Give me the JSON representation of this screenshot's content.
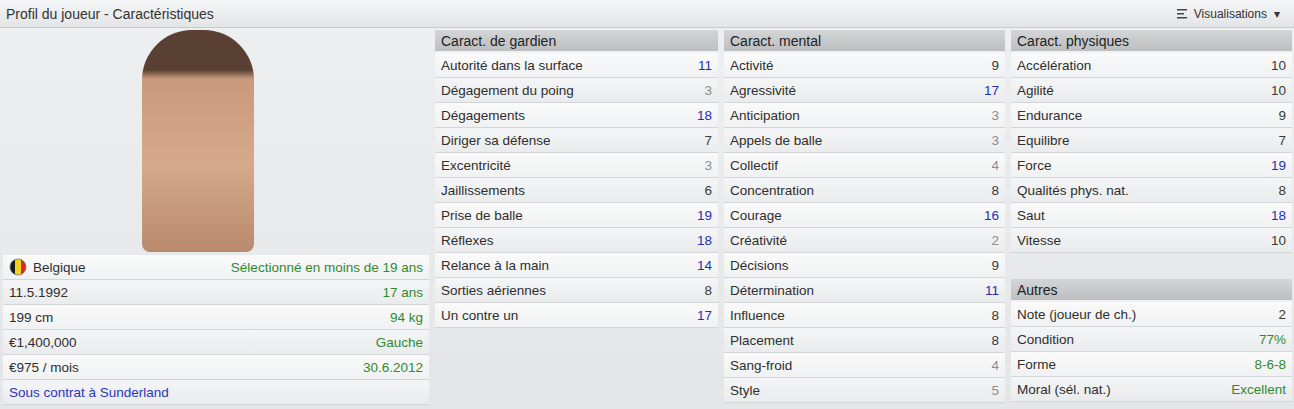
{
  "header": {
    "title": "Profil du joueur - Caractéristiques",
    "view_button": {
      "label": "Visualisations",
      "caret": "▾"
    }
  },
  "player": {
    "info_rows": [
      {
        "kind": "nation",
        "label": "Belgique",
        "value": "Sélectionné en moins de 19 ans"
      },
      {
        "kind": "pair",
        "label": "11.5.1992",
        "value": "17 ans"
      },
      {
        "kind": "pair",
        "label": "199 cm",
        "value": "94 kg"
      },
      {
        "kind": "pair",
        "label": "€1,400,000",
        "value": "Gauche"
      },
      {
        "kind": "pair",
        "label": "€975 / mois",
        "value": "30.6.2012"
      },
      {
        "kind": "link",
        "label": "Sous contrat à Sunderland",
        "value": ""
      }
    ]
  },
  "columns": [
    {
      "sections": [
        {
          "title": "Caract. de gardien",
          "attributes": [
            {
              "label": "Autorité dans la surface",
              "value": "11",
              "color": "#1f2fb4"
            },
            {
              "label": "Dégagement du poing",
              "value": "3",
              "color": "#8c8c8c"
            },
            {
              "label": "Dégagements",
              "value": "18",
              "color": "#1f2fb4"
            },
            {
              "label": "Diriger sa défense",
              "value": "7",
              "color": "#3a3a3a"
            },
            {
              "label": "Excentricité",
              "value": "3",
              "color": "#8c8c8c"
            },
            {
              "label": "Jaillissements",
              "value": "6",
              "color": "#3a3a3a"
            },
            {
              "label": "Prise de balle",
              "value": "19",
              "color": "#1f2fb4"
            },
            {
              "label": "Réflexes",
              "value": "18",
              "color": "#1f2fb4"
            },
            {
              "label": "Relance à la main",
              "value": "14",
              "color": "#1f2fb4"
            },
            {
              "label": "Sorties aériennes",
              "value": "8",
              "color": "#3a3a3a"
            },
            {
              "label": "Un contre un",
              "value": "17",
              "color": "#1f2fb4"
            }
          ]
        }
      ]
    },
    {
      "sections": [
        {
          "title": "Caract. mental",
          "attributes": [
            {
              "label": "Activité",
              "value": "9",
              "color": "#3a3a3a"
            },
            {
              "label": "Agressivité",
              "value": "17",
              "color": "#1f2fb4"
            },
            {
              "label": "Anticipation",
              "value": "3",
              "color": "#8c8c8c"
            },
            {
              "label": "Appels de balle",
              "value": "3",
              "color": "#8c8c8c"
            },
            {
              "label": "Collectif",
              "value": "4",
              "color": "#8c8c8c"
            },
            {
              "label": "Concentration",
              "value": "8",
              "color": "#3a3a3a"
            },
            {
              "label": "Courage",
              "value": "16",
              "color": "#1f2fb4"
            },
            {
              "label": "Créativité",
              "value": "2",
              "color": "#8c8c8c"
            },
            {
              "label": "Décisions",
              "value": "9",
              "color": "#3a3a3a"
            },
            {
              "label": "Détermination",
              "value": "11",
              "color": "#1f2fb4"
            },
            {
              "label": "Influence",
              "value": "8",
              "color": "#3a3a3a"
            },
            {
              "label": "Placement",
              "value": "8",
              "color": "#3a3a3a"
            },
            {
              "label": "Sang-froid",
              "value": "4",
              "color": "#8c8c8c"
            },
            {
              "label": "Style",
              "value": "5",
              "color": "#8c8c8c"
            }
          ]
        }
      ]
    },
    {
      "sections": [
        {
          "title": "Caract. physiques",
          "attributes": [
            {
              "label": "Accélération",
              "value": "10",
              "color": "#3a3a3a"
            },
            {
              "label": "Agilité",
              "value": "10",
              "color": "#3a3a3a"
            },
            {
              "label": "Endurance",
              "value": "9",
              "color": "#3a3a3a"
            },
            {
              "label": "Equilibre",
              "value": "7",
              "color": "#3a3a3a"
            },
            {
              "label": "Force",
              "value": "19",
              "color": "#1f2fb4"
            },
            {
              "label": "Qualités phys. nat.",
              "value": "8",
              "color": "#3a3a3a"
            },
            {
              "label": "Saut",
              "value": "18",
              "color": "#1f2fb4"
            },
            {
              "label": "Vitesse",
              "value": "10",
              "color": "#3a3a3a"
            }
          ]
        },
        {
          "title": "Autres",
          "attributes": [
            {
              "label": "Note (joueur de ch.)",
              "value": "2",
              "color": "#3a3a3a"
            },
            {
              "label": "Condition",
              "value": "77%",
              "color": "#2e8b2e"
            },
            {
              "label": "Forme",
              "value": "8-6-8",
              "color": "#2e8b2e"
            },
            {
              "label": "Moral (sél. nat.)",
              "value": "Excellent",
              "color": "#2e8b2e"
            }
          ]
        }
      ]
    }
  ]
}
